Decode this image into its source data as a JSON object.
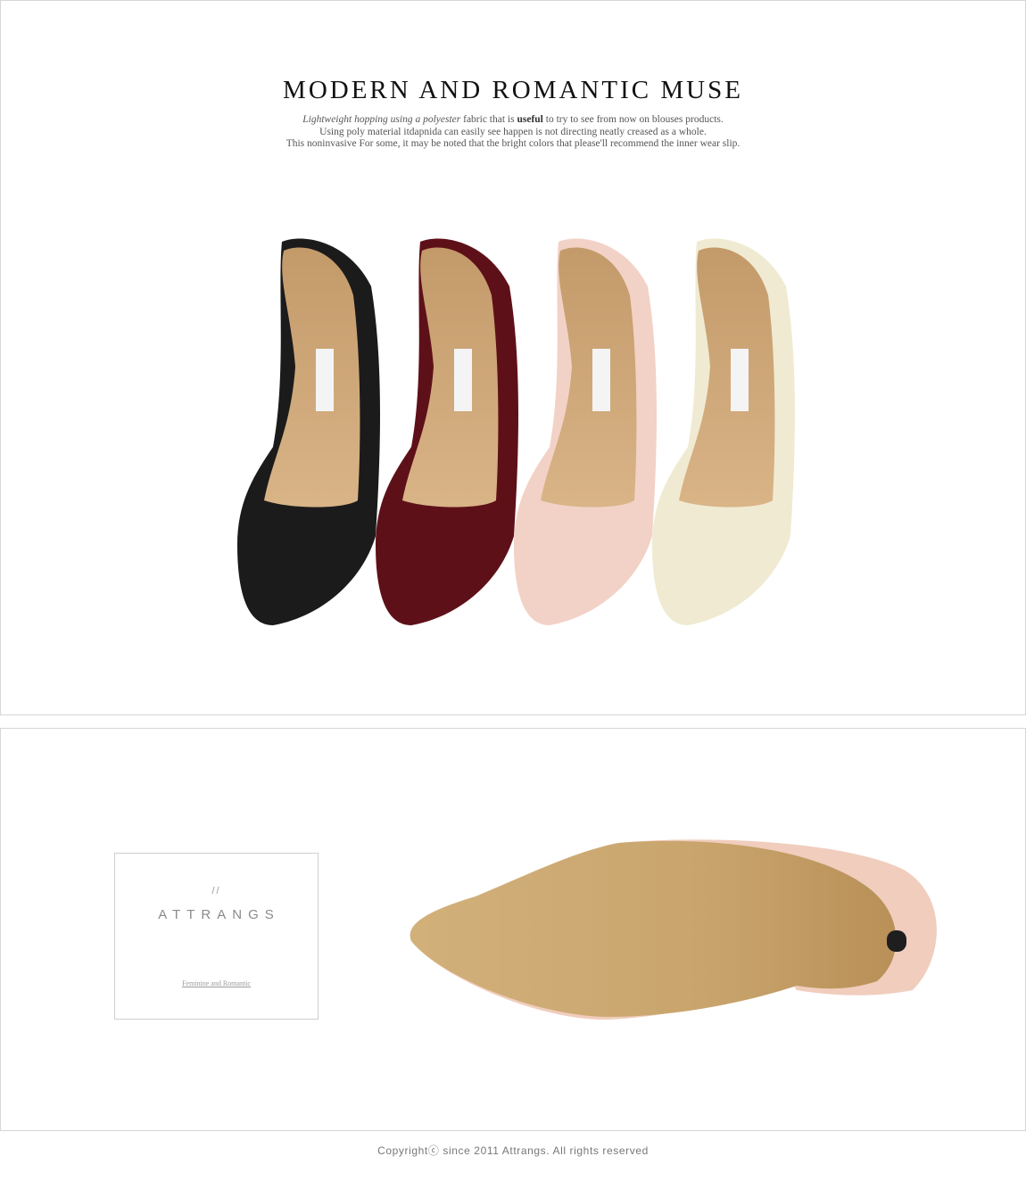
{
  "headline": "MODERN AND ROMANTIC MUSE",
  "description": {
    "line1_italic": "Lightweight hopping using a polyester",
    "line1_a": " fabric that is ",
    "line1_bold": "useful",
    "line1_b": " to try to see from now on blouses products.",
    "line2": "Using poly material itdapnida can easily see happen is not directing neatly creased as a whole.",
    "line3": "This noninvasive For some, it may be noted that the bright colors that please'll recommend the inner wear slip."
  },
  "shoes": [
    {
      "name": "black",
      "color": "#1b1b1b"
    },
    {
      "name": "burgundy",
      "color": "#5e1019"
    },
    {
      "name": "pink",
      "color": "#f2d2c6"
    },
    {
      "name": "cream",
      "color": "#f0ead2"
    }
  ],
  "brand": {
    "slash": "//",
    "name": "ATTRANGS",
    "tagline": "Feminine and Romantic"
  },
  "copyright": "Copyrightⓒ since 2011 Attrangs. All rights reserved"
}
